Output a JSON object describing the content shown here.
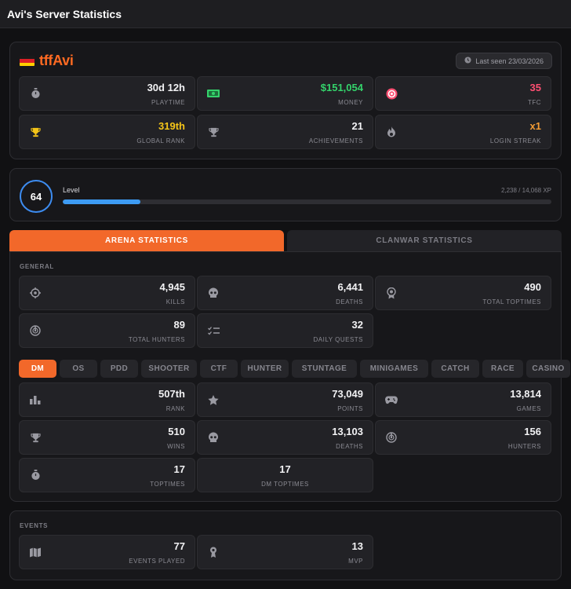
{
  "window": {
    "title": "Avi's Server Statistics"
  },
  "profile": {
    "name": "tffAvi",
    "flag_icon": "germany-flag-icon",
    "last_seen": "Last seen 23/03/2026"
  },
  "summary": [
    {
      "value": "30d 12h",
      "label": "PLAYTIME",
      "icon": "stopwatch-icon",
      "color": "#f2f2f4"
    },
    {
      "value": "$151,054",
      "label": "MONEY",
      "icon": "money-icon",
      "color": "#34d36b"
    },
    {
      "value": "35",
      "label": "TFC",
      "icon": "tfc-coin-icon",
      "color": "#ff4f72"
    },
    {
      "value": "319th",
      "label": "GLOBAL RANK",
      "icon": "trophy-icon",
      "color": "#f5c518"
    },
    {
      "value": "21",
      "label": "ACHIEVEMENTS",
      "icon": "trophy-icon",
      "color": "#f2f2f4"
    },
    {
      "value": "x1",
      "label": "LOGIN STREAK",
      "icon": "fire-icon",
      "color": "#f39c34"
    }
  ],
  "level": {
    "number": "64",
    "label": "Level",
    "xp_text": "2,238 / 14,068 XP",
    "progress": 0.159
  },
  "main_tabs": [
    {
      "label": "ARENA STATISTICS",
      "active": true
    },
    {
      "label": "CLANWAR STATISTICS",
      "active": false
    }
  ],
  "general": {
    "label": "GENERAL",
    "stats": [
      {
        "value": "4,945",
        "label": "KILLS",
        "icon": "crosshair-icon"
      },
      {
        "value": "6,441",
        "label": "DEATHS",
        "icon": "skull-icon"
      },
      {
        "value": "490",
        "label": "TOTAL TOPTIMES",
        "icon": "medal-icon"
      },
      {
        "value": "89",
        "label": "TOTAL HUNTERS",
        "icon": "radar-icon"
      },
      {
        "value": "32",
        "label": "DAILY QUESTS",
        "icon": "checklist-icon"
      }
    ]
  },
  "mode_tabs": [
    {
      "label": "DM",
      "active": true
    },
    {
      "label": "OS"
    },
    {
      "label": "PDD"
    },
    {
      "label": "SHOOTER"
    },
    {
      "label": "CTF"
    },
    {
      "label": "HUNTER"
    },
    {
      "label": "STUNTAGE"
    },
    {
      "label": "MINIGAMES"
    },
    {
      "label": "CATCH"
    },
    {
      "label": "RACE"
    },
    {
      "label": "CASINO"
    }
  ],
  "mode_stats": [
    {
      "value": "507th",
      "label": "RANK",
      "icon": "bar-chart-icon"
    },
    {
      "value": "73,049",
      "label": "POINTS",
      "icon": "star-icon"
    },
    {
      "value": "13,814",
      "label": "GAMES",
      "icon": "gamepad-icon"
    },
    {
      "value": "510",
      "label": "WINS",
      "icon": "trophy-icon"
    },
    {
      "value": "13,103",
      "label": "DEATHS",
      "icon": "skull-icon"
    },
    {
      "value": "156",
      "label": "HUNTERS",
      "icon": "radar-icon"
    },
    {
      "value": "17",
      "label": "TOPTIMES",
      "icon": "stopwatch-icon"
    },
    {
      "value": "17",
      "label": "DM TOPTIMES",
      "icon": ""
    }
  ],
  "events": {
    "label": "EVENTS",
    "stats": [
      {
        "value": "77",
        "label": "EVENTS PLAYED",
        "icon": "map-icon"
      },
      {
        "value": "13",
        "label": "MVP",
        "icon": "award-icon"
      }
    ]
  }
}
